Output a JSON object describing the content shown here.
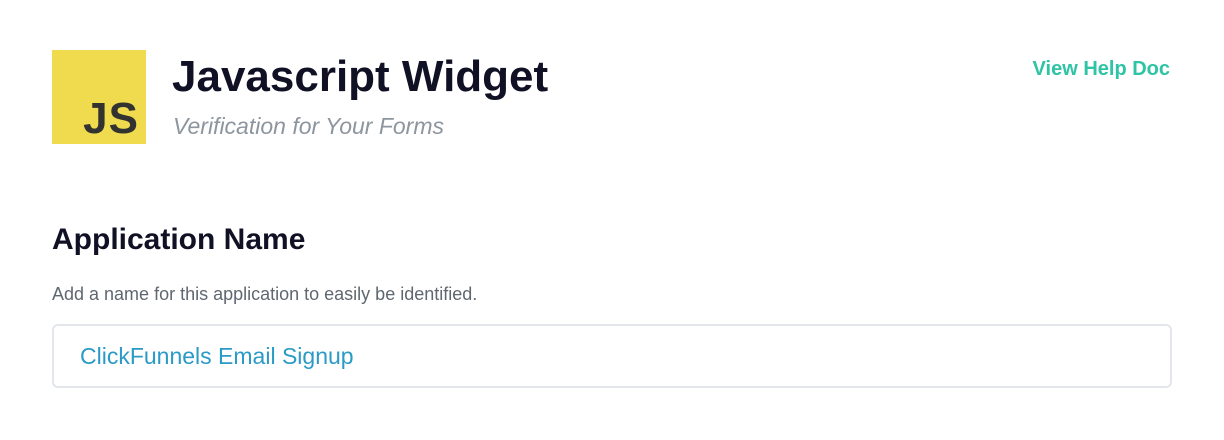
{
  "header": {
    "logo_text": "JS",
    "title": "Javascript Widget",
    "subtitle": "Verification for Your Forms",
    "help_link": "View Help Doc"
  },
  "application_name": {
    "heading": "Application Name",
    "description": "Add a name for this application to easily be identified.",
    "input_value": "ClickFunnels Email Signup"
  },
  "colors": {
    "logo_bg": "#f0db4f",
    "logo_text": "#323330",
    "heading_text": "#111126",
    "subtitle_text": "#8d959e",
    "link": "#2ec4a5",
    "input_text": "#2b9ac6",
    "input_border": "#e3e6ea"
  }
}
